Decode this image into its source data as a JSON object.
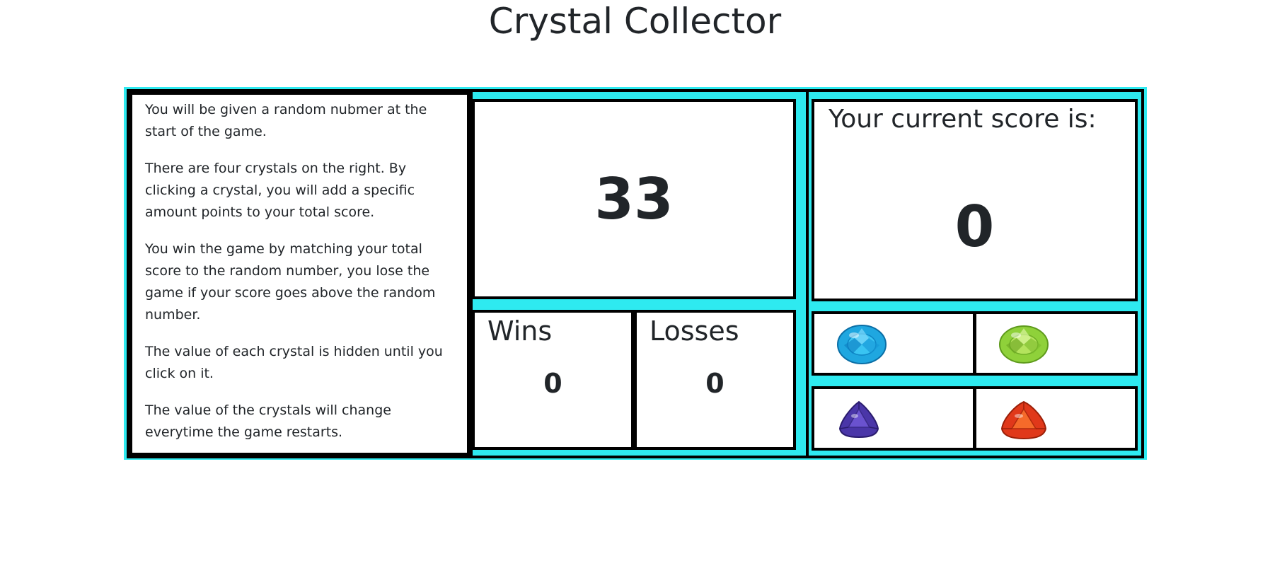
{
  "page": {
    "title": "Crystal Collector"
  },
  "instructions": {
    "paragraphs": [
      "You will be given a random nubmer at the start of the game.",
      "There are four crystals on the right. By clicking a crystal, you will add a specific amount points to your total score.",
      "You win the game by matching your total score to the random number, you lose the game if your score goes above the random number.",
      "The value of each crystal is hidden until you click on it.",
      "The value of the crystals will change everytime the game restarts."
    ]
  },
  "target": {
    "number": "33"
  },
  "stats": {
    "wins_label": "Wins",
    "wins_value": "0",
    "losses_label": "Losses",
    "losses_value": "0"
  },
  "score": {
    "label": "Your current score is:",
    "value": "0"
  },
  "crystals": [
    {
      "icon": "blue-oval-crystal-icon",
      "color": "#1fa7e0"
    },
    {
      "icon": "green-oval-crystal-icon",
      "color": "#8fd13a"
    },
    {
      "icon": "purple-trillion-crystal-icon",
      "color": "#4a36a8"
    },
    {
      "icon": "red-trillion-crystal-icon",
      "color": "#e0381a"
    }
  ],
  "theme": {
    "frame_color": "#2eeaf0",
    "border_color": "#000000"
  }
}
